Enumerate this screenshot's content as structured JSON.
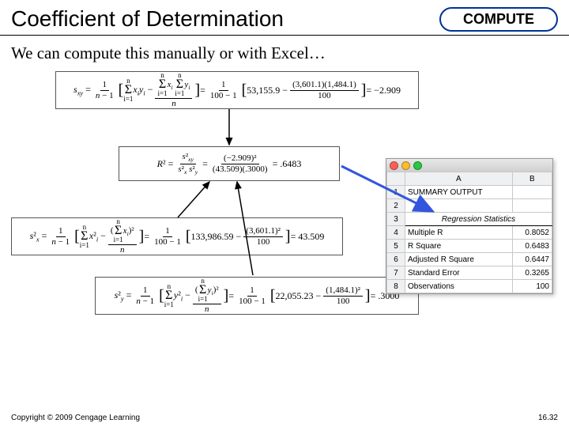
{
  "header": {
    "title": "Coefficient of Determination",
    "badge": "COMPUTE"
  },
  "subtitle": "We can compute this manually or with Excel…",
  "formulas": {
    "sxy": {
      "lhs": "s_{xy} =",
      "frac1_num": "1",
      "frac1_den": "n − 1",
      "sigma1": "Σ xᵢyᵢ −",
      "big_frac_num": "Σxᵢ Σyᵢ",
      "big_frac_den": "n",
      "eq2": " = ",
      "frac2_num": "1",
      "frac2_den": "100 − 1",
      "bracket_a": "53,155.9 −",
      "bracket_frac_num": "(3,601.1)(1,484.1)",
      "bracket_frac_den": "100",
      "result": " = −2.909"
    },
    "r2": {
      "lhs": "R² =",
      "frac1_num": "s²_{xy}",
      "frac1_den": "s²_x s²_y",
      "eq": " = ",
      "frac2_num": "(−2.909)²",
      "frac2_den": "(43.509)(.3000)",
      "result": " = .6483"
    },
    "sx2": {
      "lhs": "s²_x =",
      "frac1_num": "1",
      "frac1_den": "n − 1",
      "sigma": "Σ x²ᵢ −",
      "bigfrac_num": "(Σxᵢ)²",
      "bigfrac_den": "n",
      "eq": " = ",
      "frac2_num": "1",
      "frac2_den": "100 − 1",
      "bracket_a": "133,986.59 −",
      "bracket_frac_num": "(3,601.1)²",
      "bracket_frac_den": "100",
      "result": " = 43.509"
    },
    "sy2": {
      "lhs": "s²_y =",
      "frac1_num": "1",
      "frac1_den": "n − 1",
      "sigma": "Σ y²ᵢ −",
      "bigfrac_num": "(Σyᵢ)²",
      "bigfrac_den": "n",
      "eq": " = ",
      "frac2_num": "1",
      "frac2_den": "100 − 1",
      "bracket_a": "22,055.23 −",
      "bracket_frac_num": "(1,484.1)²",
      "bracket_frac_den": "100",
      "result": " = .3000"
    }
  },
  "excel": {
    "columns": [
      "",
      "A",
      "B"
    ],
    "rows": [
      {
        "n": "1",
        "a": "SUMMARY OUTPUT",
        "b": ""
      },
      {
        "n": "2",
        "a": "",
        "b": ""
      },
      {
        "n": "3",
        "a": "Regression Statistics",
        "b": "",
        "section": true
      },
      {
        "n": "4",
        "a": "Multiple R",
        "b": "0.8052"
      },
      {
        "n": "5",
        "a": "R Square",
        "b": "0.6483"
      },
      {
        "n": "6",
        "a": "Adjusted R Square",
        "b": "0.6447"
      },
      {
        "n": "7",
        "a": "Standard Error",
        "b": "0.3265"
      },
      {
        "n": "8",
        "a": "Observations",
        "b": "100"
      }
    ]
  },
  "footer": {
    "copyright": "Copyright © 2009 Cengage Learning",
    "pagenum": "16.32"
  },
  "chart_data": {
    "type": "table",
    "title": "Regression Statistics (Excel SUMMARY OUTPUT)",
    "rows": [
      {
        "label": "Multiple R",
        "value": 0.8052
      },
      {
        "label": "R Square",
        "value": 0.6483
      },
      {
        "label": "Adjusted R Square",
        "value": 0.6447
      },
      {
        "label": "Standard Error",
        "value": 0.3265
      },
      {
        "label": "Observations",
        "value": 100
      }
    ],
    "computed": {
      "s_xy": -2.909,
      "s_x2": 43.509,
      "s_y2": 0.3,
      "R2": 0.6483,
      "n": 100,
      "sum_x": 3601.1,
      "sum_y": 1484.1,
      "sum_xy": 53155.9,
      "sum_x2": 133986.59,
      "sum_y2": 22055.23
    }
  }
}
